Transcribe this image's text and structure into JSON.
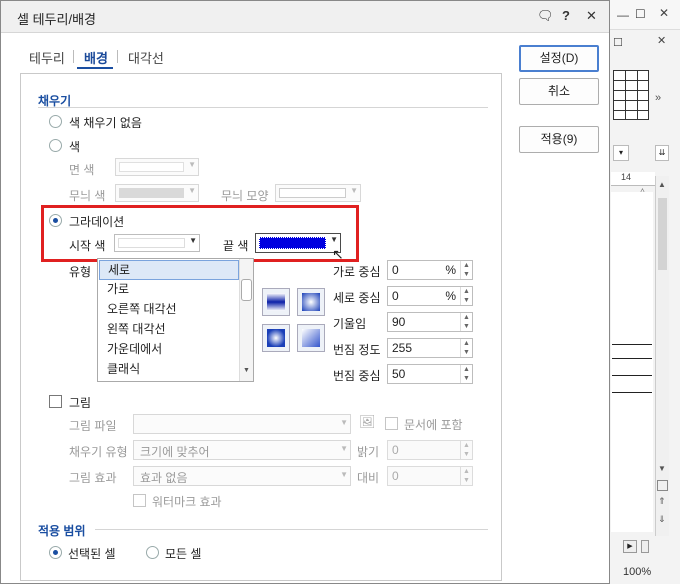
{
  "dialog": {
    "title": "셀 테두리/배경",
    "tabs": [
      "테두리",
      "배경",
      "대각선"
    ],
    "active_tab": "배경",
    "fill_section": "채우기",
    "no_fill": "색 채우기 없음",
    "color": "색",
    "face_color": "면 색",
    "pattern_color": "무늬 색",
    "pattern_shape": "무늬 모양",
    "gradient": "그라데이션",
    "start_color": "시작 색",
    "end_color": "끝 색",
    "type_label": "유형",
    "type_list": [
      "세로",
      "가로",
      "오른쪽 대각선",
      "왼쪽 대각선",
      "가운데에서",
      "클래식"
    ],
    "type_selected": "세로",
    "h_center_label": "가로 중심",
    "h_center": "0",
    "v_center_label": "세로 중심",
    "v_center": "0",
    "percent": "%",
    "slope_label": "기울임",
    "slope": "90",
    "blur_label": "번짐 정도",
    "blur": "255",
    "blur_center_label": "번짐 중심",
    "blur_center": "50",
    "picture": "그림",
    "picture_file": "그림 파일",
    "include_in_doc": "문서에 포함",
    "fill_type": "채우기 유형",
    "fill_type_value": "크기에 맞추어",
    "brightness": "밝기",
    "brightness_value": "0",
    "picture_effect": "그림 효과",
    "picture_effect_value": "효과 없음",
    "contrast": "대비",
    "contrast_value": "0",
    "watermark": "워터마크 효과",
    "apply_section": "적용 범위",
    "selected_cells": "선택된 셀",
    "all_cells": "모든 셀"
  },
  "buttons": {
    "ok": "설정(D)",
    "cancel": "취소",
    "apply": "적용(9)"
  },
  "colors": {
    "start": "#ffffff",
    "end": "#0000e0",
    "pattern": "#d9d9d9",
    "accent": "#1a4ea1",
    "highlight": "#e02020"
  },
  "background_app": {
    "ruler_mark": "14",
    "zoom": "100%"
  }
}
